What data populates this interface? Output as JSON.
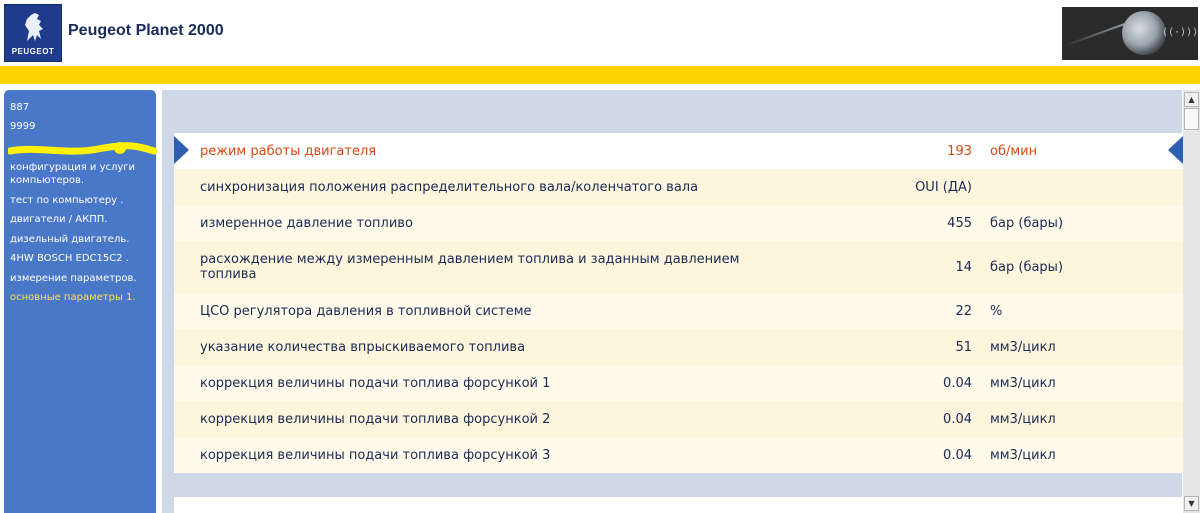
{
  "header": {
    "brand_logo_text": "PEUGEOT",
    "app_title": "Peugeot Planet 2000"
  },
  "sidebar": {
    "items": [
      {
        "label": "887"
      },
      {
        "label": "9999"
      },
      {
        "label": "конфигурация и услуги компьютеров."
      },
      {
        "label": "тест по компьютеру ."
      },
      {
        "label": "двигатели /  АКПП."
      },
      {
        "label": "дизельный двигатель."
      },
      {
        "label": "4HW BOSCH EDC15C2 ."
      },
      {
        "label": "измерение параметров."
      },
      {
        "label": "основные параметры 1."
      }
    ]
  },
  "parameters": [
    {
      "label": "режим работы двигателя",
      "value": "193",
      "unit": "об/мин",
      "selected": true
    },
    {
      "label": "синхронизация положения распределительного вала/коленчатого вала",
      "value": "OUI (ДА)",
      "unit": ""
    },
    {
      "label": "измеренное давление топливо",
      "value": "455",
      "unit": "бар (бары)"
    },
    {
      "label": "расхождение между измеренным давлением топлива и заданным давлением топлива",
      "value": "14",
      "unit": "бар (бары)"
    },
    {
      "label": "ЦСО регулятора давления в топливной системе",
      "value": "22",
      "unit": "%"
    },
    {
      "label": "указание количества впрыскиваемого топлива",
      "value": "51",
      "unit": "мм3/цикл"
    },
    {
      "label": "коррекция величины подачи топлива форсункой 1",
      "value": "0.04",
      "unit": "мм3/цикл"
    },
    {
      "label": "коррекция величины подачи топлива форсункой 2",
      "value": "0.04",
      "unit": "мм3/цикл"
    },
    {
      "label": "коррекция величины подачи топлива форсункой 3",
      "value": "0.04",
      "unit": "мм3/цикл"
    }
  ],
  "colors": {
    "accent_yellow": "#ffd400",
    "sidebar_blue": "#4a78c8",
    "selected_text": "#d84a12",
    "text_navy": "#1b2a55"
  }
}
